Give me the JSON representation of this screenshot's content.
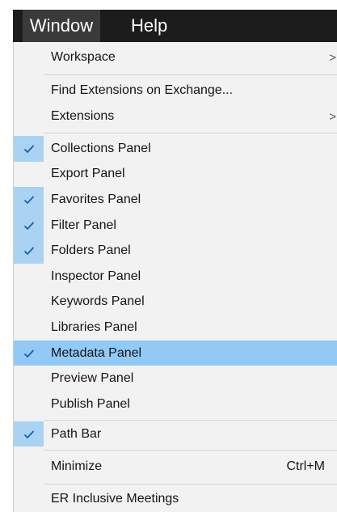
{
  "menubar": {
    "items": [
      {
        "label": "Window"
      },
      {
        "label": "Help"
      }
    ]
  },
  "menu": {
    "workspace": {
      "label": "Workspace",
      "submenu": true
    },
    "find_extensions": {
      "label": "Find Extensions on Exchange..."
    },
    "extensions": {
      "label": "Extensions",
      "submenu": true
    },
    "panels": [
      {
        "label": "Collections Panel",
        "checked": true
      },
      {
        "label": "Export Panel",
        "checked": false
      },
      {
        "label": "Favorites Panel",
        "checked": true
      },
      {
        "label": "Filter Panel",
        "checked": true
      },
      {
        "label": "Folders Panel",
        "checked": true
      },
      {
        "label": "Inspector Panel",
        "checked": false
      },
      {
        "label": "Keywords Panel",
        "checked": false
      },
      {
        "label": "Libraries Panel",
        "checked": false
      },
      {
        "label": "Metadata Panel",
        "checked": true,
        "highlighted": true
      },
      {
        "label": "Preview Panel",
        "checked": false
      },
      {
        "label": "Publish Panel",
        "checked": false
      }
    ],
    "path_bar": {
      "label": "Path Bar",
      "checked": true
    },
    "minimize": {
      "label": "Minimize",
      "shortcut": "Ctrl+M"
    },
    "er_meetings": {
      "label": "ER Inclusive Meetings"
    },
    "submenu_arrow": ">"
  },
  "colors": {
    "menubar_bg": "#1c1c1c",
    "menu_bg": "#f2f2f2",
    "check_bg": "#a9d2f3",
    "highlight_bg": "#91c9f7",
    "checkmark": "#1e5fa8"
  },
  "icons": [
    "checkmark-icon",
    "chevron-right-icon"
  ]
}
